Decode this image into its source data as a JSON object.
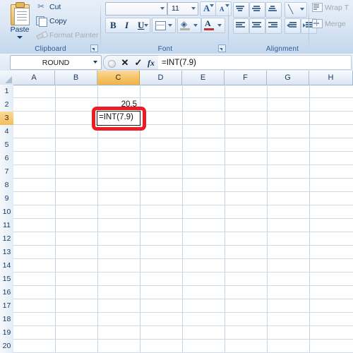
{
  "ribbon": {
    "groups": [
      {
        "name": "clipboard",
        "label": "Clipboard",
        "paste_label": "Paste",
        "items": [
          {
            "label": "Cut",
            "icon": "scissors-icon",
            "disabled": false
          },
          {
            "label": "Copy",
            "icon": "copy-icon",
            "disabled": false
          },
          {
            "label": "Format Painter",
            "icon": "format-painter-icon",
            "disabled": true
          }
        ]
      },
      {
        "name": "font",
        "label": "Font",
        "font_name_value": "",
        "font_name_placeholder": "",
        "font_size_value": "11",
        "grow_font_label": "A",
        "shrink_font_label": "A",
        "bold_label": "B",
        "italic_label": "I",
        "underline_label": "U"
      },
      {
        "name": "alignment",
        "label": "Alignment",
        "wrap_text_label": "Wrap T",
        "merge_label": "Merge"
      }
    ]
  },
  "formula_bar": {
    "name_box_value": "ROUND",
    "cancel_label": "✕",
    "enter_label": "✓",
    "insert_function_label": "fx",
    "formula_value": "=INT(7.9)"
  },
  "grid": {
    "columns": [
      "A",
      "B",
      "C",
      "D",
      "E",
      "F",
      "G",
      "H"
    ],
    "rows": [
      "1",
      "2",
      "3",
      "4",
      "5",
      "6",
      "7",
      "8",
      "9",
      "10",
      "11",
      "12",
      "13",
      "14",
      "15",
      "16",
      "17",
      "18",
      "19",
      "20"
    ],
    "selected_column": "C",
    "selected_row": "3",
    "cells": [
      {
        "ref": "C2",
        "value": "20.5",
        "align": "right"
      }
    ],
    "edit_cell": {
      "ref": "C3",
      "value": "=INT(7.9)"
    }
  },
  "annotation": {
    "highlight_color": "#ec1c24",
    "target": "C3"
  }
}
